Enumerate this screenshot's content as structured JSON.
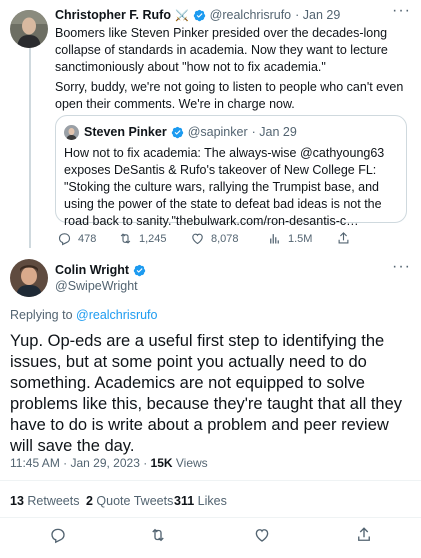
{
  "thread_tweet": {
    "author_name": "Christopher F. Rufo",
    "author_flair": "⚔️",
    "author_handle": "@realchrisrufo",
    "date": "· Jan 29",
    "text_p1": "Boomers like Steven Pinker presided over the decades-long collapse of standards in academia. Now they want to lecture sanctimoniously about \"how not to fix academia.\"",
    "text_p2": "Sorry, buddy, we're not going to listen to people who can't even open their comments. We're in charge now.",
    "quote": {
      "author_name": "Steven Pinker",
      "author_handle": "@sapinker",
      "date": "· Jan 29",
      "text_a": "How not to fix academia: The always-wise ",
      "mention": "@cathyoung63",
      "text_b": " exposes DeSantis & Rufo's takeover of New College FL: \"Stoking the culture wars, rallying the Trumpist base, and using the power of the state to defeat bad ideas is not the road back to sanity.\"",
      "link": "thebulwark.com/ron-desantis-c…"
    },
    "actions": {
      "replies": "478",
      "retweets": "1,245",
      "likes": "8,078",
      "views": "1.5M"
    }
  },
  "main_tweet": {
    "author_name": "Colin Wright",
    "author_handle": "@SwipeWright",
    "replying_to_prefix": "Replying to ",
    "replying_to_handle": "@realchrisrufo",
    "text": "Yup. Op-eds are a useful first step to identifying the issues, but at some point you actually need to do something. Academics are not equipped to solve problems like this, because they're taught that all they have to do is write about a problem and peer review will save the day.",
    "timestamp": "11:45 AM · Jan 29, 2023 · ",
    "views_count": "15K",
    "views_label": " Views",
    "stats": {
      "retweets_count": "13",
      "retweets_label": " Retweets",
      "quotes_count": "2",
      "quotes_label": " Quote Tweets",
      "likes_count": "311",
      "likes_label": " Likes"
    }
  },
  "colors": {
    "accent": "#1d9bf0",
    "secondary_text": "#536471",
    "divider": "#eff3f4"
  }
}
